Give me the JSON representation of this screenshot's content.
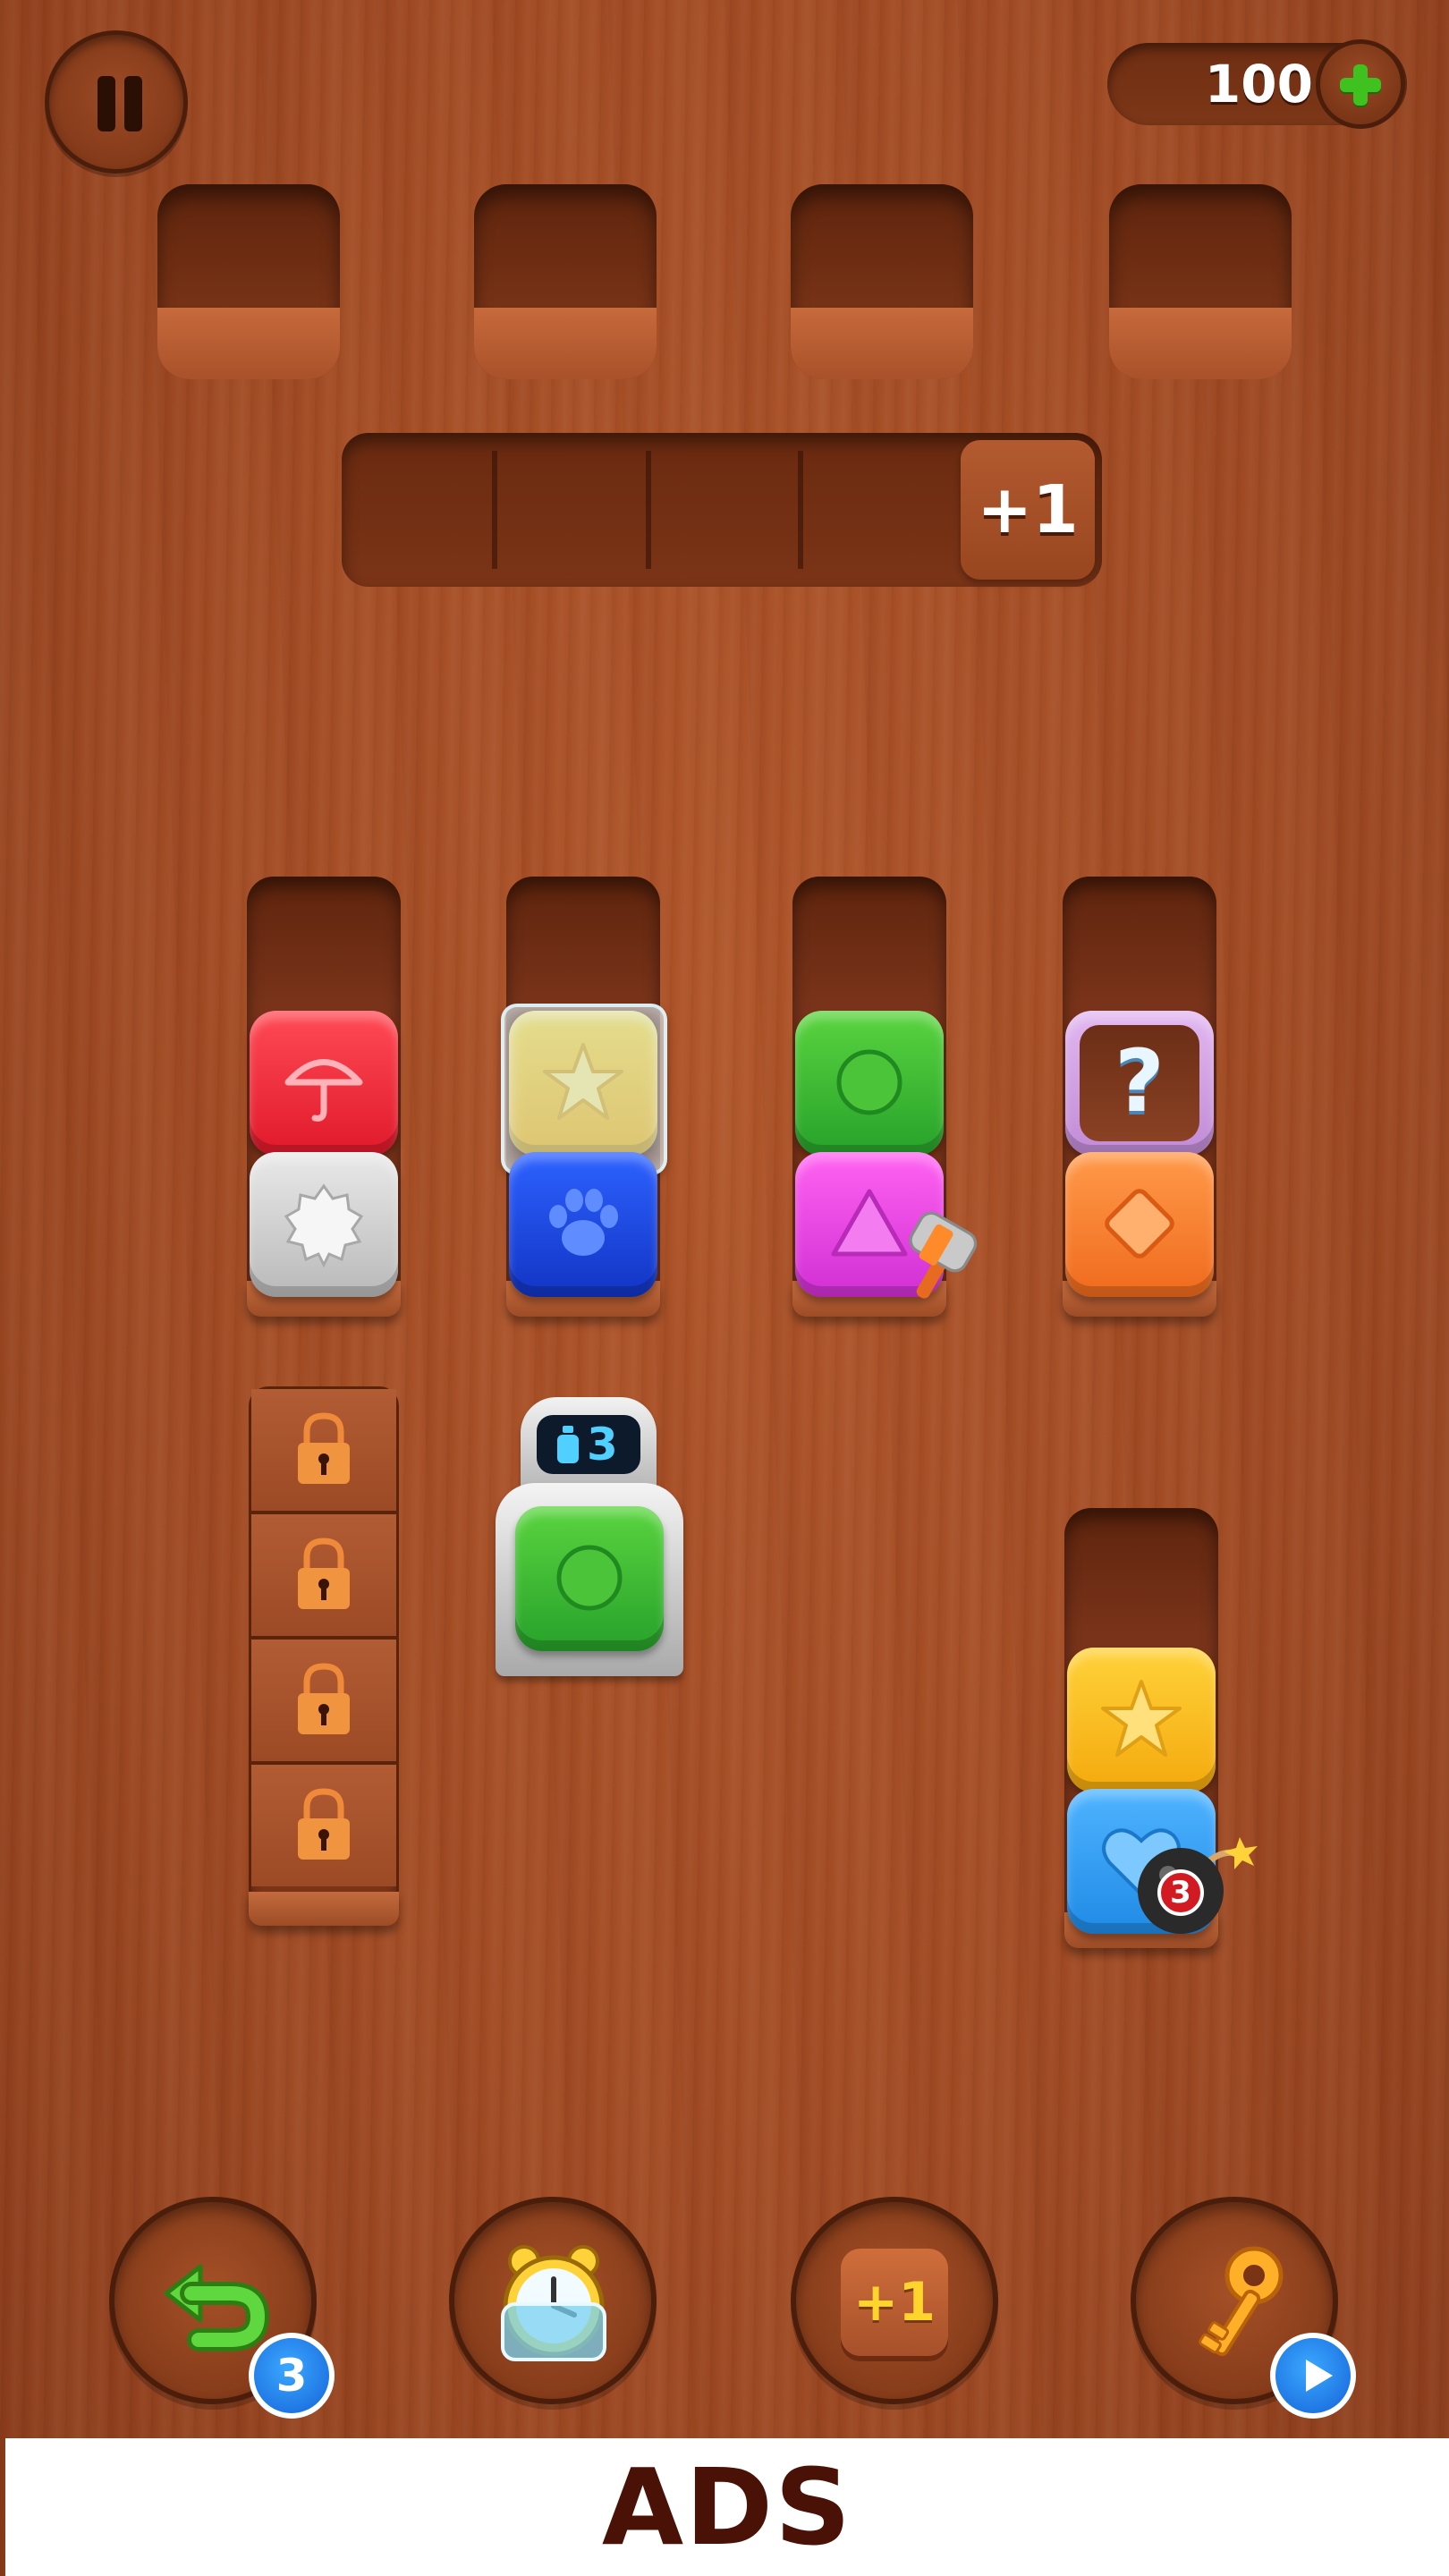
{
  "hud": {
    "coins": "100"
  },
  "tray": {
    "extra_slot_label": "+1"
  },
  "board": {
    "columns": [
      {
        "id": 1,
        "tiles": [
          {
            "color": "red",
            "icon": "umbrella-icon"
          },
          {
            "color": "grey",
            "icon": "gear-icon"
          }
        ]
      },
      {
        "id": 2,
        "tiles": [
          {
            "color": "yellow",
            "icon": "star-icon",
            "frozen": true
          },
          {
            "color": "blue",
            "icon": "paw-icon"
          }
        ]
      },
      {
        "id": 3,
        "tiles": [
          {
            "color": "green",
            "icon": "circle-icon"
          },
          {
            "color": "pink",
            "icon": "triangle-icon",
            "hammer": true
          }
        ]
      },
      {
        "id": 4,
        "tiles": [
          {
            "color": "mystery",
            "icon": "question-icon",
            "label": "?"
          },
          {
            "color": "orange",
            "icon": "diamond-icon"
          }
        ]
      },
      {
        "id": 5,
        "tiles": [
          {
            "color": "yellow",
            "icon": "star-icon"
          },
          {
            "color": "lightblue",
            "icon": "heart-icon",
            "bomb": "3"
          }
        ]
      }
    ],
    "locked_column": {
      "locks": 4
    },
    "dispenser": {
      "count": "3",
      "tile": {
        "color": "green",
        "icon": "circle-icon"
      }
    }
  },
  "boosters": {
    "undo": {
      "icon": "undo-arrow-icon",
      "count": "3"
    },
    "freeze": {
      "icon": "frozen-clock-icon"
    },
    "extra_slot": {
      "icon": "plus-one-icon",
      "label": "+1"
    },
    "key": {
      "icon": "key-icon",
      "action": "play-ad-icon"
    }
  },
  "ads_banner": {
    "text": "ADS"
  },
  "colors": {
    "wood": "#a04a23",
    "accent_green": "#3fc21f",
    "badge_blue": "#1f7ae6",
    "ads_text": "#4a1206"
  }
}
